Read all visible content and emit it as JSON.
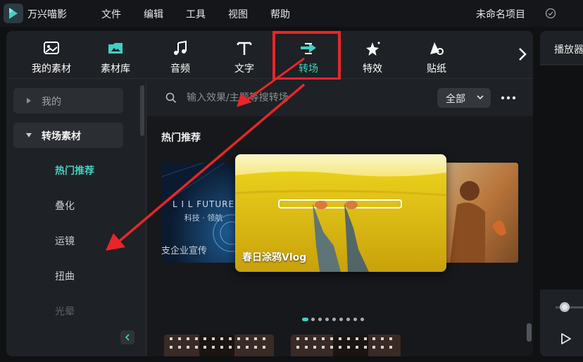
{
  "app": {
    "name": "万兴喵影",
    "project_name": "未命名项目"
  },
  "menu": [
    "文件",
    "编辑",
    "工具",
    "视图",
    "帮助"
  ],
  "tabs": [
    {
      "label": "我的素材",
      "icon": "my-media-icon"
    },
    {
      "label": "素材库",
      "icon": "stock-library-icon"
    },
    {
      "label": "音频",
      "icon": "music-note-icon"
    },
    {
      "label": "文字",
      "icon": "text-icon"
    },
    {
      "label": "转场",
      "icon": "transition-icon",
      "active": true
    },
    {
      "label": "特效",
      "icon": "effects-sparkle-icon"
    },
    {
      "label": "贴纸",
      "icon": "sticker-icon"
    }
  ],
  "sidebar": {
    "top_items": [
      {
        "label": "我的",
        "expanded": false
      },
      {
        "label": "转场素材",
        "expanded": true
      }
    ],
    "sub_items": [
      "热门推荐",
      "叠化",
      "运镜",
      "扭曲",
      "光晕"
    ],
    "active_sub": "热门推荐"
  },
  "search": {
    "placeholder": "输入效果/主题等搜转场",
    "value": ""
  },
  "filter": {
    "selected": "全部"
  },
  "section": {
    "title": "热门推荐"
  },
  "carousel": {
    "main_caption": "春日涂鸦Vlog",
    "left_card": {
      "line1": "L I L FUTURE",
      "line2": "科技 · 领航",
      "caption": "支企业宣传"
    },
    "dots_total": 9,
    "active_dot": 0
  },
  "player": {
    "title": "播放器",
    "progress": 0.05
  },
  "colors": {
    "accent": "#3fd1c3",
    "annotation": "#e8262a",
    "panel": "#1e2125",
    "background": "#0f1113"
  }
}
